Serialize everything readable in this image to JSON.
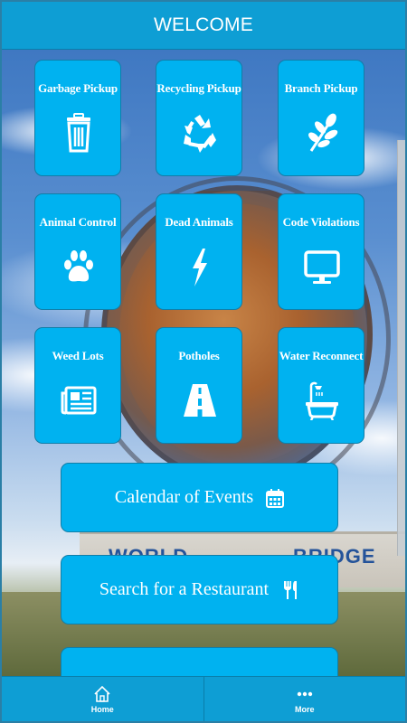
{
  "header": {
    "title": "WELCOME"
  },
  "background": {
    "sign_left": "WORLD",
    "sign_right": "BRIDGE"
  },
  "tiles": [
    {
      "label": "Garbage Pickup",
      "icon": "trash-can-icon"
    },
    {
      "label": "Recycling Pickup",
      "icon": "recycle-icon"
    },
    {
      "label": "Branch Pickup",
      "icon": "leaf-branch-icon"
    },
    {
      "label": "Animal Control",
      "icon": "paw-icon"
    },
    {
      "label": "Dead Animals",
      "icon": "lightning-bolt-icon"
    },
    {
      "label": "Code Violations",
      "icon": "monitor-icon"
    },
    {
      "label": "Weed Lots",
      "icon": "newspaper-icon"
    },
    {
      "label": "Potholes",
      "icon": "road-icon"
    },
    {
      "label": "Water Reconnect",
      "icon": "bathtub-icon"
    }
  ],
  "buttons": [
    {
      "label": "Calendar of Events",
      "icon": "calendar-icon"
    },
    {
      "label": "Search for a Restaurant",
      "icon": "utensils-icon"
    }
  ],
  "bottom_nav": [
    {
      "label": "Home",
      "icon": "home-icon"
    },
    {
      "label": "More",
      "icon": "more-dots-icon"
    }
  ],
  "colors": {
    "accent": "#00b2f0",
    "bar": "#0e9ed4",
    "tile_border": "#117ea8"
  }
}
